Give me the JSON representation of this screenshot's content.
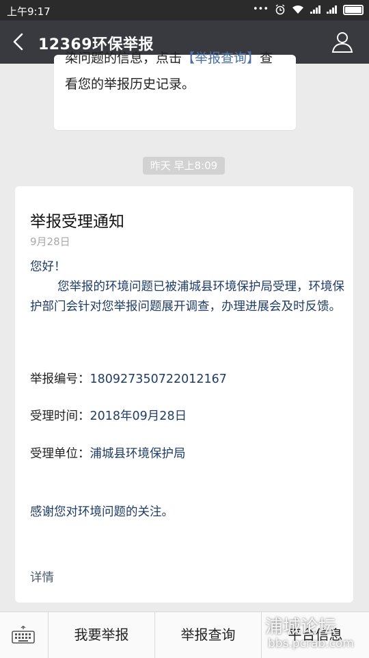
{
  "status_bar": {
    "time": "上午9:17",
    "icons": [
      "more-dots-icon",
      "alarm-icon",
      "wifi-icon",
      "signal-icon",
      "signal-icon",
      "battery-icon"
    ]
  },
  "header": {
    "title": "12369环保举报",
    "back_icon": "back-arrow-icon",
    "user_icon": "user-profile-icon"
  },
  "previous_message": {
    "line1_a": "染问题的信息，点击",
    "line1_link": "【举报查询】",
    "line1_b": "查",
    "line2": "看您的举报历史记录。"
  },
  "timestamp": "昨天 早上8:09",
  "notice": {
    "title": "举报受理通知",
    "date": "9月28日",
    "greeting": "您好！",
    "body": "您举报的环境问题已被浦城县环境保护局受理，环境保护部门会针对您举报问题展开调查，办理进展会及时反馈。",
    "fields": [
      {
        "label": "举报编号：",
        "value": "180927350722012167"
      },
      {
        "label": "受理时间：",
        "value": "2018年09月28日"
      },
      {
        "label": "受理单位：",
        "value": "浦城县环境保护局"
      }
    ],
    "thanks": "感谢您对环境问题的关注。",
    "detail_link": "详情"
  },
  "bottom_menu": {
    "keyboard_icon": "keyboard-icon",
    "items": [
      "我要举报",
      "举报查询",
      "平台信息"
    ]
  },
  "watermark": {
    "line1": "浦城论坛",
    "line2": "bbs.pcrab.com"
  },
  "colors": {
    "statusbar": "#2b2b2b",
    "titlebar": "#393a3f",
    "background": "#ebebeb",
    "body_text": "#1f3c66",
    "link": "#4a6fa5"
  }
}
